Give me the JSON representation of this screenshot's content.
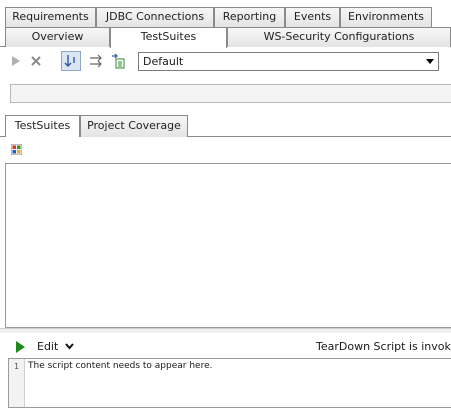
{
  "top_tabs_row1": [
    "Requirements",
    "JDBC Connections",
    "Reporting",
    "Events",
    "Environments"
  ],
  "top_tabs_row2": [
    "Overview",
    "TestSuites",
    "WS-Security Configurations"
  ],
  "active_top_tab": "TestSuites",
  "toolbar": {
    "icons": [
      "run-icon",
      "cancel-icon",
      "sequential-icon",
      "parallel-icon",
      "new-testsuite-icon"
    ],
    "environment_value": "Default"
  },
  "inner_tabs": [
    "TestSuites",
    "Project Coverage"
  ],
  "active_inner_tab": "TestSuites",
  "panel": {
    "icon": "grid-icon"
  },
  "script_editor": {
    "edit_label": "Edit",
    "title": "TearDown Script is invoke",
    "line_number": "1",
    "content": "The script content needs to appear here."
  },
  "colors": {
    "run_green": "#1a8a1a",
    "tab_border": "#8a8a8a"
  }
}
